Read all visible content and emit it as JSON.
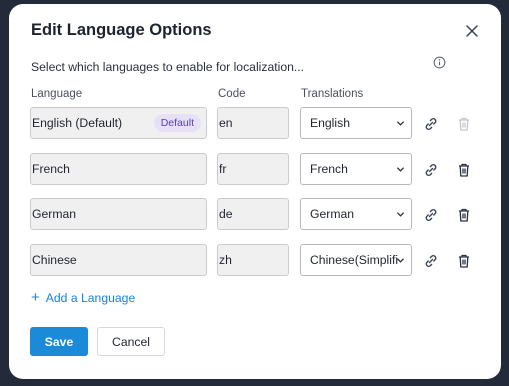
{
  "dialog": {
    "title": "Edit Language Options",
    "subtitle": "Select which languages to enable for localization..."
  },
  "columns": {
    "language": "Language",
    "code": "Code",
    "translations": "Translations"
  },
  "rows": [
    {
      "language": "English (Default)",
      "badge": "Default",
      "code": "en",
      "translation": "English",
      "delete_disabled": true
    },
    {
      "language": "French",
      "code": "fr",
      "translation": "French",
      "delete_disabled": false
    },
    {
      "language": "German",
      "code": "de",
      "translation": "German",
      "delete_disabled": false
    },
    {
      "language": "Chinese",
      "code": "zh",
      "translation": "Chinese(Simplified)",
      "delete_disabled": false
    }
  ],
  "actions": {
    "add_language": "Add a Language",
    "save": "Save",
    "cancel": "Cancel"
  },
  "colors": {
    "accent": "#1a8ad9",
    "badge_bg": "#e7e1f7",
    "badge_text": "#5b3fb5",
    "backdrop": "#232a3a"
  },
  "icons": [
    "close-icon",
    "info-icon",
    "chevron-down-icon",
    "link-icon",
    "trash-icon",
    "plus-icon"
  ]
}
